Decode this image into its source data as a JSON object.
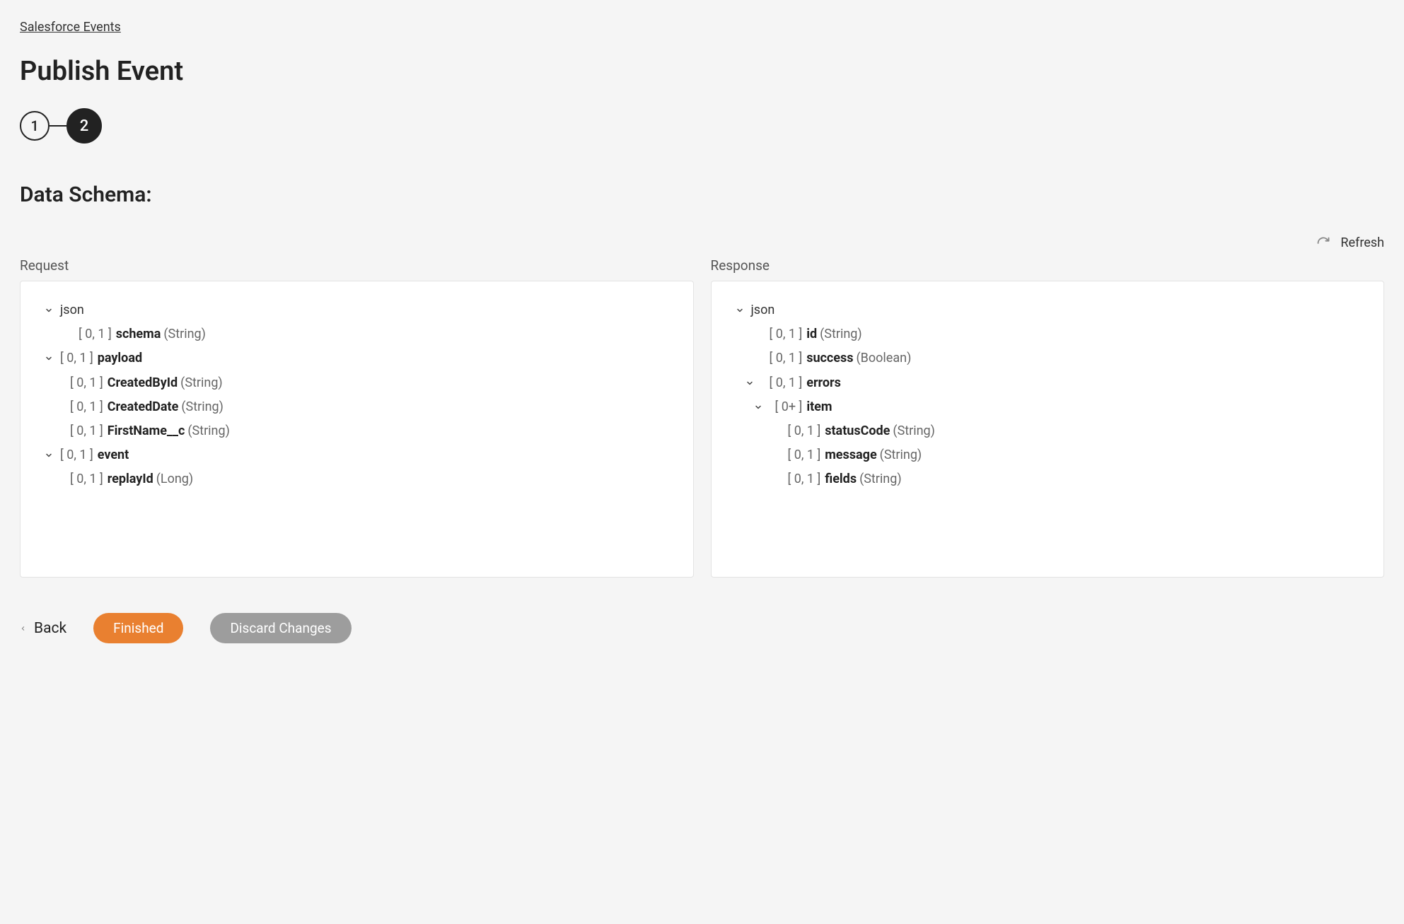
{
  "breadcrumb": {
    "link": "Salesforce Events"
  },
  "page_title": "Publish Event",
  "stepper": {
    "step1": "1",
    "step2": "2"
  },
  "section_title": "Data Schema:",
  "refresh": {
    "label": "Refresh"
  },
  "panels": {
    "request": {
      "label": "Request",
      "root": "json",
      "rows": [
        {
          "card": "[ 0, 1 ]",
          "name": "schema",
          "type": "(String)"
        },
        {
          "card": "[ 0, 1 ]",
          "name": "payload",
          "type": ""
        },
        {
          "card": "[ 0, 1 ]",
          "name": "CreatedById",
          "type": "(String)"
        },
        {
          "card": "[ 0, 1 ]",
          "name": "CreatedDate",
          "type": "(String)"
        },
        {
          "card": "[ 0, 1 ]",
          "name": "FirstName__c",
          "type": "(String)"
        },
        {
          "card": "[ 0, 1 ]",
          "name": "event",
          "type": ""
        },
        {
          "card": "[ 0, 1 ]",
          "name": "replayId",
          "type": "(Long)"
        }
      ]
    },
    "response": {
      "label": "Response",
      "root": "json",
      "rows": [
        {
          "card": "[ 0, 1 ]",
          "name": "id",
          "type": "(String)"
        },
        {
          "card": "[ 0, 1 ]",
          "name": "success",
          "type": "(Boolean)"
        },
        {
          "card": "[ 0, 1 ]",
          "name": "errors",
          "type": ""
        },
        {
          "card": "[ 0+ ]",
          "name": "item",
          "type": ""
        },
        {
          "card": "[ 0, 1 ]",
          "name": "statusCode",
          "type": "(String)"
        },
        {
          "card": "[ 0, 1 ]",
          "name": "message",
          "type": "(String)"
        },
        {
          "card": "[ 0, 1 ]",
          "name": "fields",
          "type": "(String)"
        }
      ]
    }
  },
  "actions": {
    "back": "Back",
    "finished": "Finished",
    "discard": "Discard Changes"
  }
}
